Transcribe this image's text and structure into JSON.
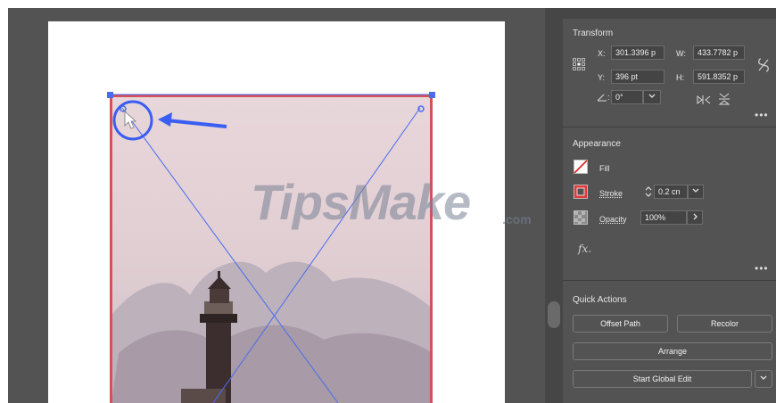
{
  "transform": {
    "title": "Transform",
    "x_label": "X:",
    "x_value": "301.3396 p",
    "y_label": "Y:",
    "y_value": "396 pt",
    "w_label": "W:",
    "w_value": "433.7782 p",
    "h_label": "H:",
    "h_value": "591.8352 p",
    "angle_value": "0°"
  },
  "appearance": {
    "title": "Appearance",
    "fill_label": "Fill",
    "stroke_label": "Stroke",
    "stroke_value": "0.2 cn",
    "opacity_label": "Opacity",
    "opacity_value": "100%",
    "fx_label": "fx."
  },
  "quick_actions": {
    "title": "Quick Actions",
    "offset_path": "Offset Path",
    "recolor": "Recolor",
    "arrange": "Arrange",
    "start_global_edit": "Start Global Edit"
  },
  "watermark": {
    "brand": "TipsMake",
    "suffix": ".com"
  },
  "colors": {
    "selection_border": "#d4505a",
    "guide_blue": "#4a6cf0",
    "panel_bg": "#535353"
  }
}
